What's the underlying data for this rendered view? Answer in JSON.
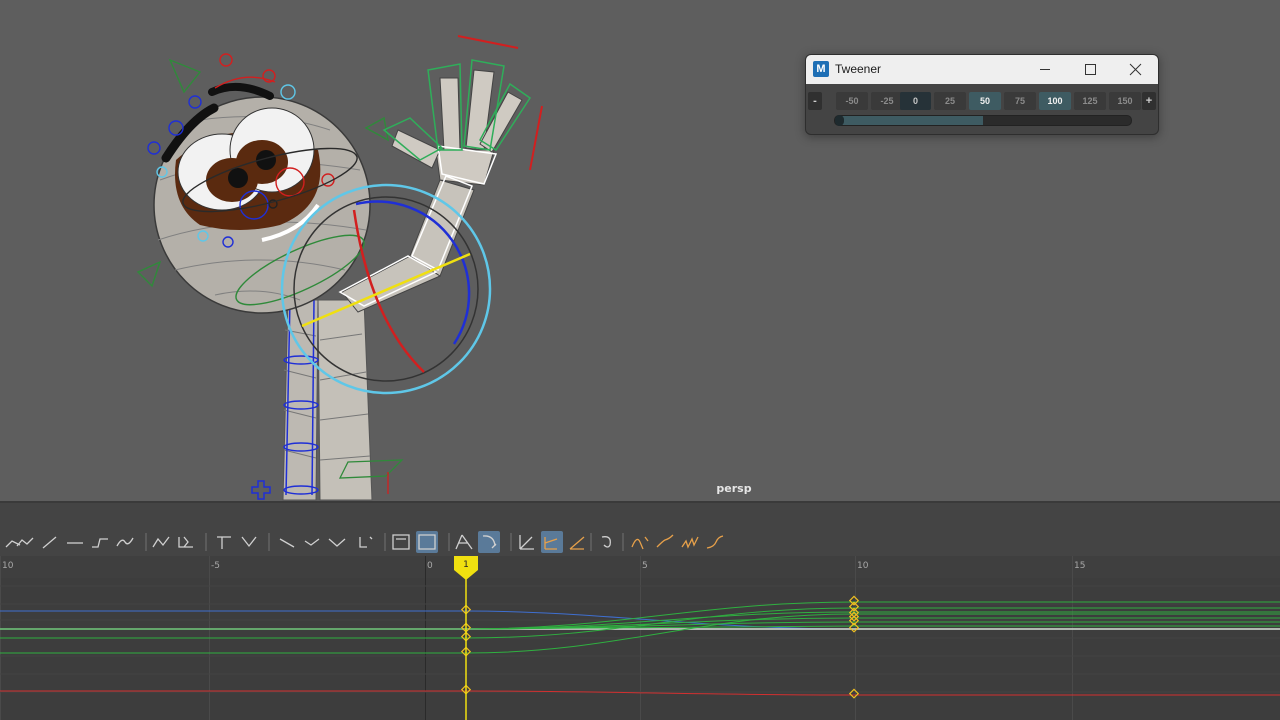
{
  "viewport": {
    "camera_label": "persp"
  },
  "tweener": {
    "title": "Tweener",
    "logo_letter": "M",
    "buttons": [
      {
        "label": "-",
        "style": "sign"
      },
      {
        "label": "-50",
        "style": "dim"
      },
      {
        "label": "-25",
        "style": "dim"
      },
      {
        "label": "0",
        "style": "mid"
      },
      {
        "label": "25",
        "style": "dim"
      },
      {
        "label": "50",
        "style": "mid"
      },
      {
        "label": "75",
        "style": "dim"
      },
      {
        "label": "100",
        "style": "mid"
      },
      {
        "label": "125",
        "style": "dim"
      },
      {
        "label": "150",
        "style": "dim"
      },
      {
        "label": "+",
        "style": "sign"
      }
    ],
    "slider_fraction": 0.5,
    "window_controls": [
      "minimize-icon",
      "maximize-icon",
      "close-icon"
    ]
  },
  "graph_editor": {
    "ruler_labels": [
      "10",
      "-5",
      "0",
      "5",
      "10",
      "15"
    ],
    "current_frame": "1",
    "toolbar_icons": [
      "move-nearest-picked-key-icon",
      "insert-keys-icon",
      "add-key-icon",
      "lattice-deform-icon",
      "auto-tangent-icon",
      "spline-tangent-icon",
      "clamped-tangent-icon",
      "value-to-time-icon",
      "time-to-value-icon",
      "break-tangent-icon",
      "unify-tangent-icon",
      "free-tangent-weight-icon",
      "lock-tangent-weight-icon",
      "buffer-curve-icon",
      "key-tick-icon",
      "graph-view-icon",
      "stacked-view-icon",
      "auto-frame-icon",
      "time-snap-icon",
      "normalize-icon",
      "stack-curves-icon",
      "pre-infinity-icon",
      "cycle-icon",
      "cycle-offset-icon",
      "oscillate-icon",
      "linear-icon"
    ]
  }
}
